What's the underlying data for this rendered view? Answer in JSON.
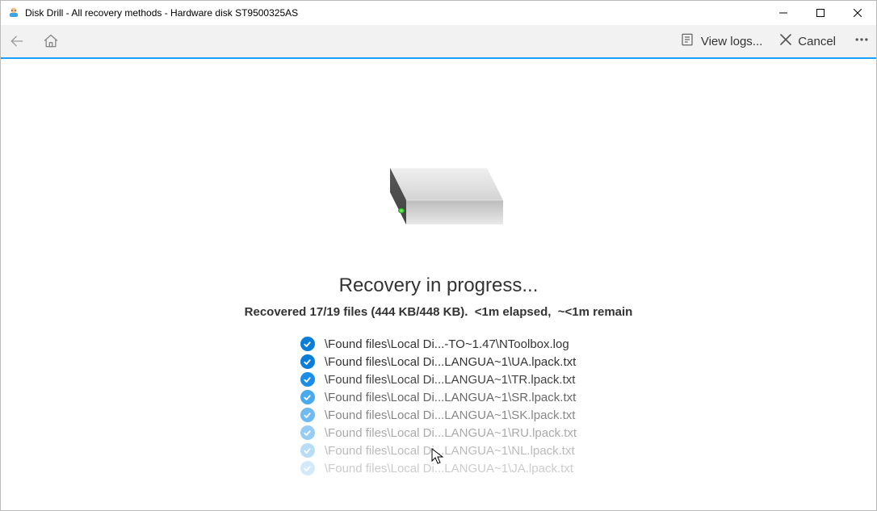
{
  "window": {
    "title": "Disk Drill - All recovery methods - Hardware disk ST9500325AS"
  },
  "toolbar": {
    "view_logs_label": "View logs...",
    "cancel_label": "Cancel"
  },
  "main": {
    "headline": "Recovery in progress...",
    "status_part1": "Recovered 17/19 files (444 KB/448 KB).",
    "status_part2": "<1m elapsed,",
    "status_part3": "~<1m remain"
  },
  "files": [
    {
      "path": "\\Found files\\Local Di...-TO~1.47\\NToolbox.log",
      "opacity": "op-100"
    },
    {
      "path": "\\Found files\\Local Di...LANGUA~1\\UA.lpack.txt",
      "opacity": "op-100"
    },
    {
      "path": "\\Found files\\Local Di...LANGUA~1\\TR.lpack.txt",
      "opacity": "op-90"
    },
    {
      "path": "\\Found files\\Local Di...LANGUA~1\\SR.lpack.txt",
      "opacity": "op-75"
    },
    {
      "path": "\\Found files\\Local Di...LANGUA~1\\SK.lpack.txt",
      "opacity": "op-60"
    },
    {
      "path": "\\Found files\\Local Di...LANGUA~1\\RU.lpack.txt",
      "opacity": "op-45"
    },
    {
      "path": "\\Found files\\Local Di...LANGUA~1\\NL.lpack.txt",
      "opacity": "op-30"
    },
    {
      "path": "\\Found files\\Local Di...LANGUA~1\\JA.lpack.txt",
      "opacity": "op-20"
    }
  ]
}
